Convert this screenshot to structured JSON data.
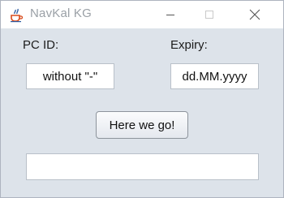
{
  "window": {
    "title": "NavKal KG",
    "icon": "java-cup-icon"
  },
  "form": {
    "pc_id_label": "PC ID:",
    "expiry_label": "Expiry:",
    "pc_id_value": "without \"-\"",
    "expiry_value": "dd.MM.yyyy",
    "submit_label": "Here we go!",
    "output_value": ""
  },
  "colors": {
    "client_bg": "#dde3ea",
    "titlebar_bg": "#ffffff",
    "title_text": "#9aa0a6"
  }
}
